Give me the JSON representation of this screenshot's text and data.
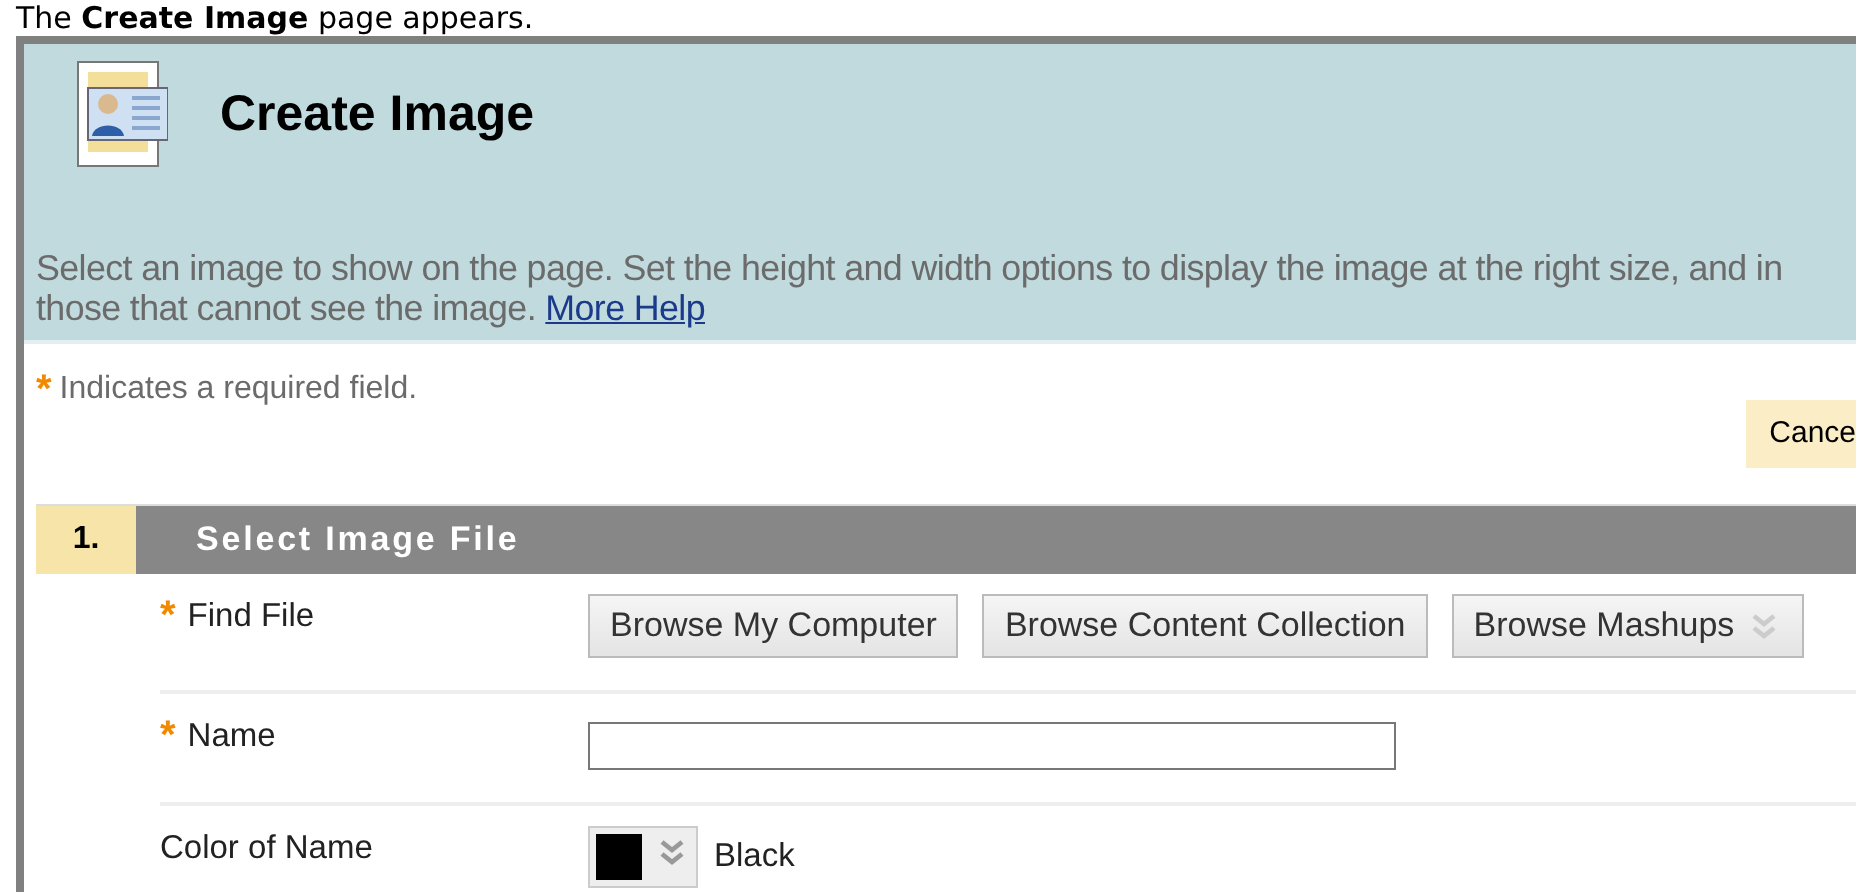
{
  "caption": "The **Create Image** page appears.",
  "page": {
    "title": "Create Image",
    "description": {
      "lines": [
        "Select an image to show on the page. Set the height and width options to display the image at the right size, and in",
        "those that cannot see the image."
      ],
      "link": "More Help"
    },
    "required_note": {
      "mark": "*",
      "text": "Indicates a required field."
    },
    "cancel_button": "Cance"
  },
  "section": {
    "number": "1.",
    "title": "Select Image File",
    "rows": [
      {
        "kind": "buttons",
        "label": "Find File",
        "required": true,
        "buttons": [
          {
            "label": "Browse My Computer",
            "menu": false
          },
          {
            "label": "Browse Content Collection",
            "menu": false
          },
          {
            "label": "Browse Mashups",
            "menu": true
          }
        ]
      },
      {
        "kind": "text",
        "label": "Name",
        "required": true
      },
      {
        "kind": "color",
        "label": "Color of Name",
        "required": false,
        "color": "#000000",
        "value": "Black"
      }
    ]
  }
}
